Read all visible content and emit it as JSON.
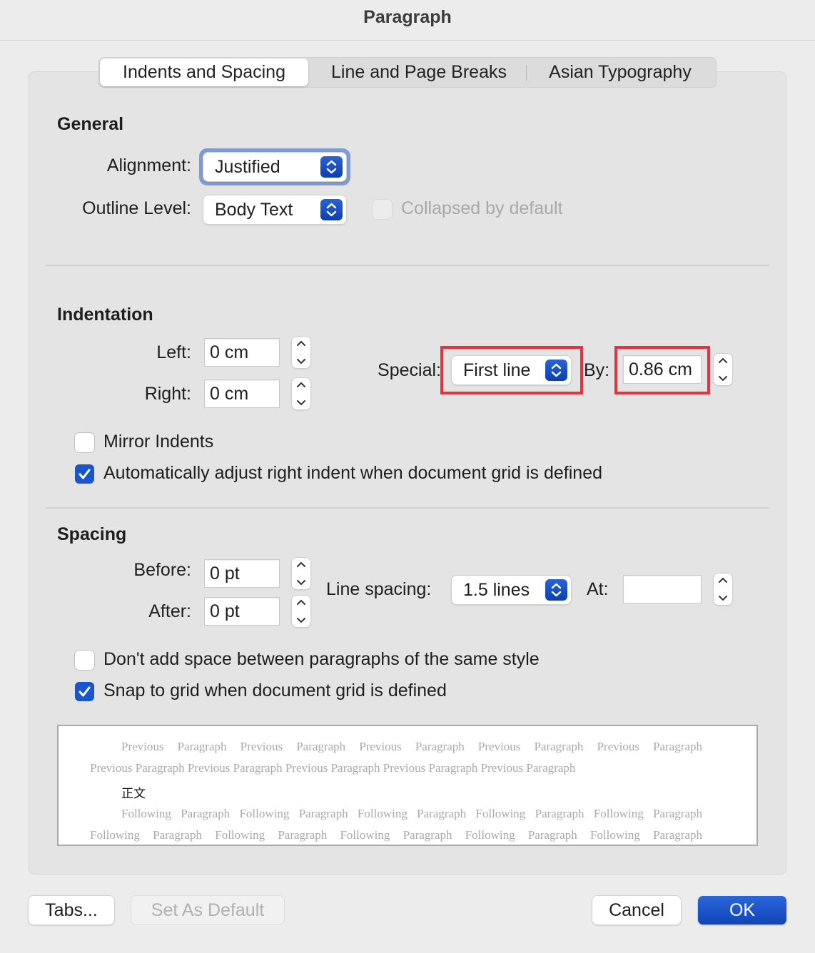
{
  "window": {
    "title": "Paragraph"
  },
  "tabs": [
    {
      "label": "Indents and Spacing",
      "selected": true
    },
    {
      "label": "Line and Page Breaks"
    },
    {
      "label": "Asian Typography"
    }
  ],
  "general": {
    "heading": "General",
    "alignment_label": "Alignment:",
    "alignment_value": "Justified",
    "outline_label": "Outline Level:",
    "outline_value": "Body Text",
    "collapsed_label": "Collapsed by default",
    "collapsed_checked": false,
    "collapsed_enabled": false
  },
  "indentation": {
    "heading": "Indentation",
    "left_label": "Left:",
    "left_value": "0 cm",
    "right_label": "Right:",
    "right_value": "0 cm",
    "special_label": "Special:",
    "special_value": "First line",
    "by_label": "By:",
    "by_value": "0.86 cm",
    "mirror_label": "Mirror Indents",
    "mirror_checked": false,
    "auto_label": "Automatically adjust right indent when document grid is defined",
    "auto_checked": true
  },
  "spacing": {
    "heading": "Spacing",
    "before_label": "Before:",
    "before_value": "0 pt",
    "after_label": "After:",
    "after_value": "0 pt",
    "line_spacing_label": "Line spacing:",
    "line_spacing_value": "1.5 lines",
    "at_label": "At:",
    "at_value": "",
    "dont_add_label": "Don't add space between paragraphs of the same style",
    "dont_add_checked": false,
    "snap_label": "Snap to grid when document grid is defined",
    "snap_checked": true
  },
  "preview": {
    "lines": [
      "Previous Paragraph Previous Paragraph Previous Paragraph Previous Paragraph Previous Paragraph",
      "Previous Paragraph Previous Paragraph Previous Paragraph Previous Paragraph Previous Paragraph",
      "正文",
      "Following Paragraph Following Paragraph Following Paragraph Following Paragraph Following Paragraph",
      "Following Paragraph Following Paragraph Following Paragraph Following Paragraph Following Paragraph"
    ]
  },
  "buttons": {
    "tabs": "Tabs...",
    "set_default": "Set As Default",
    "cancel": "Cancel",
    "ok": "OK"
  },
  "colors": {
    "accent": "#1a55d0",
    "highlight": "#e8303f"
  }
}
